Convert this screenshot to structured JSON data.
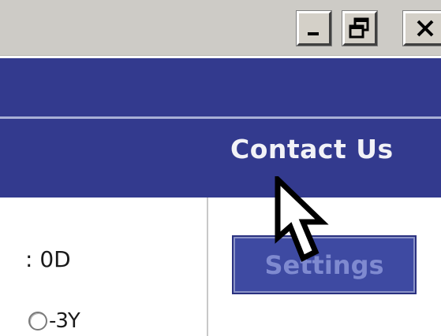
{
  "window_controls": {
    "minimize_icon": "minimize-icon",
    "restore_icon": "restore-icon",
    "close_icon": "close-icon"
  },
  "nav": {
    "contact_label": "Contact Us"
  },
  "form": {
    "field_label_fragment": ": 0D",
    "radio_option_label": "-3Y",
    "settings_label": "Settings"
  },
  "cursor": {
    "icon": "arrow-cursor-icon"
  },
  "colors": {
    "header_blue": "#333a8e",
    "settings_text": "#7f8ad0"
  }
}
